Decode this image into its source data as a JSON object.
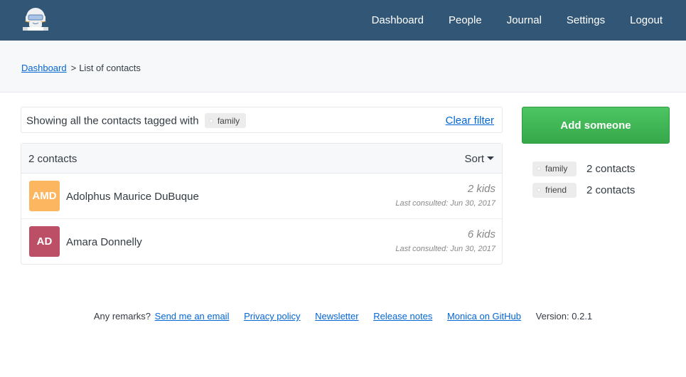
{
  "header": {
    "logo": "monica-astronaut-logo",
    "nav": [
      {
        "label": "Dashboard"
      },
      {
        "label": "People"
      },
      {
        "label": "Journal"
      },
      {
        "label": "Settings"
      },
      {
        "label": "Logout"
      }
    ],
    "background_color": "#325776"
  },
  "breadcrumb": {
    "link": "Dashboard",
    "separator": ">",
    "current": "List of contacts"
  },
  "filter": {
    "text": "Showing all the contacts tagged with",
    "tag": "family",
    "clear_label": "Clear filter"
  },
  "contacts": {
    "count_label": "2 contacts",
    "sort_label": "Sort",
    "items": [
      {
        "initials": "AMD",
        "name": "Adolphus Maurice DuBuque",
        "kids": "2 kids",
        "last_consulted": "Last consulted: Jun 30, 2017",
        "avatar_color": "#fdb660"
      },
      {
        "initials": "AD",
        "name": "Amara Donnelly",
        "kids": "6 kids",
        "last_consulted": "Last consulted: Jun 30, 2017",
        "avatar_color": "#bc4e66"
      }
    ]
  },
  "sidebar": {
    "add_label": "Add someone",
    "add_color": "#3fb854",
    "tags": [
      {
        "name": "family",
        "count": "2 contacts"
      },
      {
        "name": "friend",
        "count": "2 contacts"
      }
    ]
  },
  "footer": {
    "remarks": "Any remarks?",
    "links": [
      "Send me an email",
      "Privacy policy",
      "Newsletter",
      "Release notes",
      "Monica on GitHub"
    ],
    "version": "Version: 0.2.1"
  }
}
